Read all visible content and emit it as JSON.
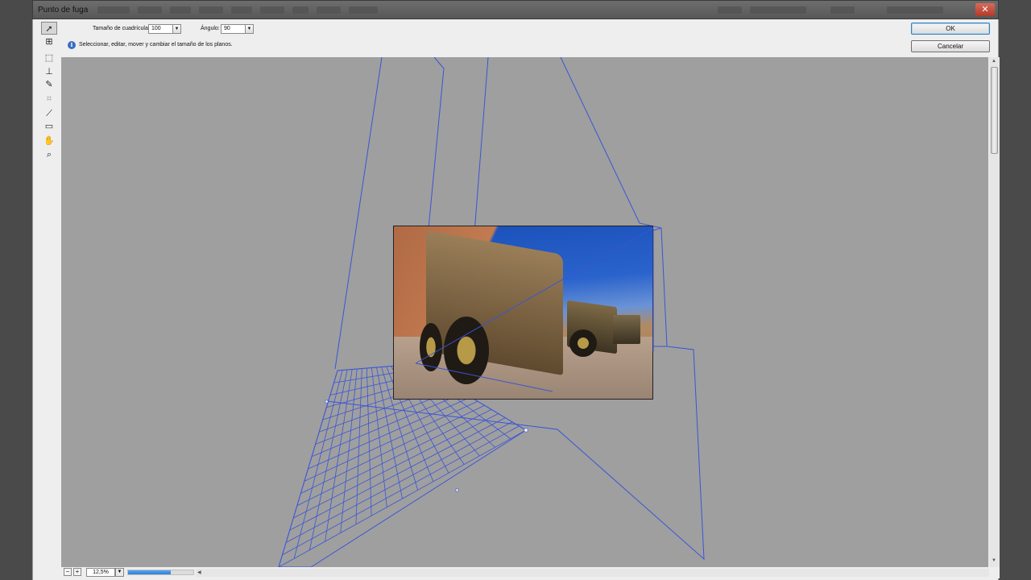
{
  "window": {
    "title": "Punto de fuga",
    "close_label": "✕"
  },
  "options": {
    "grid_size_label": "Tamaño de cuadrícula:",
    "grid_size_value": "100",
    "angle_label": "Ángulo:",
    "angle_value": "90",
    "info_text": "Seleccionar, editar, mover y cambiar el tamaño de los planos."
  },
  "buttons": {
    "ok": "OK",
    "cancel": "Cancelar"
  },
  "tools": [
    {
      "name": "edit-plane-tool",
      "icon": "arrow-cursor-icon",
      "glyph": "➚",
      "active": true
    },
    {
      "name": "create-plane-tool",
      "icon": "create-plane-icon",
      "glyph": "⊞",
      "active": false
    },
    {
      "name": "marquee-tool",
      "icon": "marquee-icon",
      "glyph": "⬚",
      "active": false
    },
    {
      "name": "stamp-tool",
      "icon": "stamp-icon",
      "glyph": "⊥",
      "active": false
    },
    {
      "name": "brush-tool",
      "icon": "brush-icon",
      "glyph": "✎",
      "active": false
    },
    {
      "name": "transform-tool",
      "icon": "transform-icon",
      "glyph": "⌗",
      "active": false
    },
    {
      "name": "eyedropper-tool",
      "icon": "eyedropper-icon",
      "glyph": "⟋",
      "active": false
    },
    {
      "name": "measure-tool",
      "icon": "ruler-icon",
      "glyph": "▭",
      "active": false
    },
    {
      "name": "hand-tool",
      "icon": "hand-icon",
      "glyph": "✋",
      "active": false
    },
    {
      "name": "zoom-tool",
      "icon": "magnifier-icon",
      "glyph": "⌕",
      "active": false
    }
  ],
  "status": {
    "zoom_out": "−",
    "zoom_in": "+",
    "zoom_value": "12,5%",
    "progress": 0.65
  },
  "colors": {
    "grid_line": "#3a55d6",
    "canvas_bg": "#9f9f9f"
  }
}
